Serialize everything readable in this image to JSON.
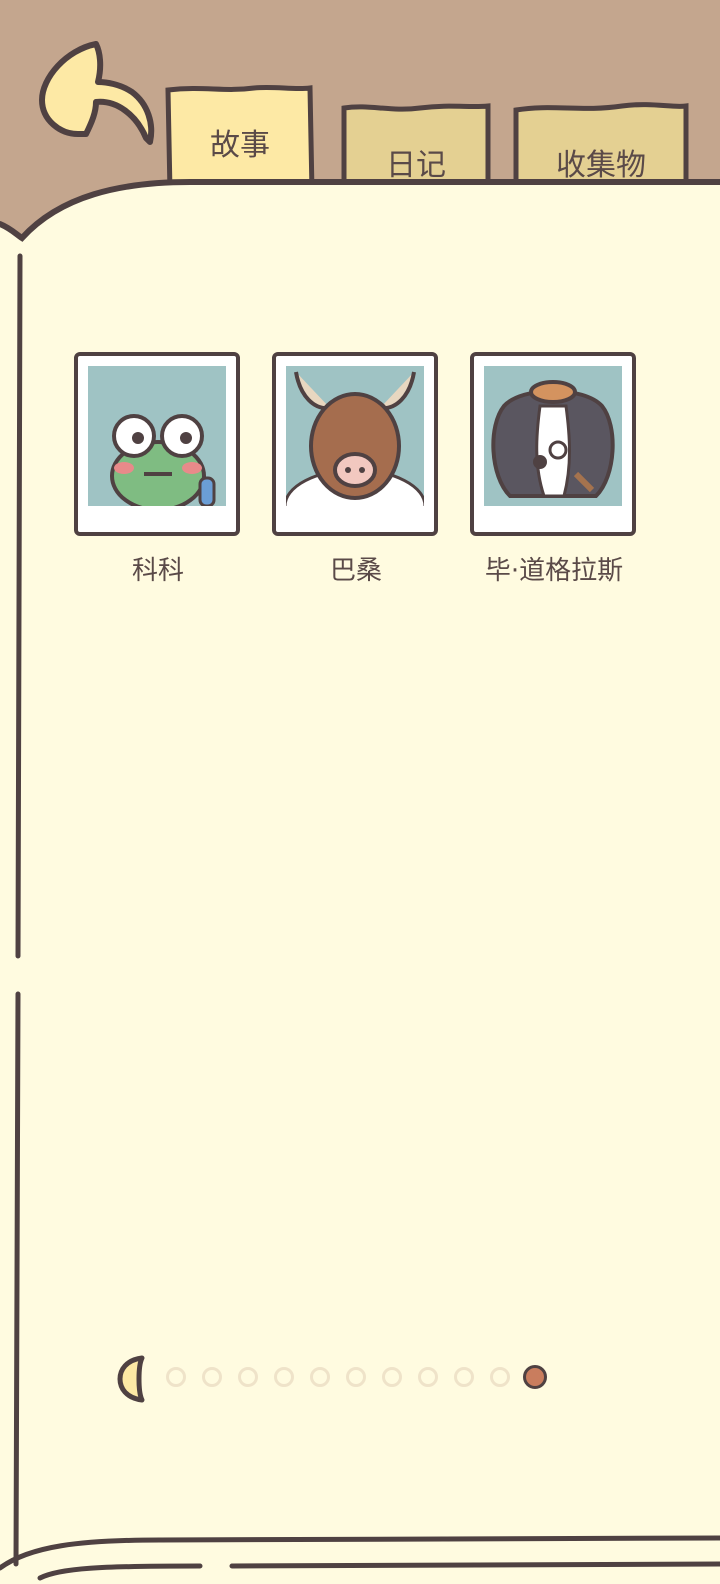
{
  "tabs": [
    {
      "label": "故事",
      "active": true
    },
    {
      "label": "日记",
      "active": false
    },
    {
      "label": "收集物",
      "active": false
    }
  ],
  "characters": [
    {
      "name": "科科",
      "icon": "frog-portrait"
    },
    {
      "name": "巴桑",
      "icon": "yak-portrait"
    },
    {
      "name": "毕·道格拉斯",
      "icon": "dog-portrait"
    }
  ],
  "pagination": {
    "total_dots": 11,
    "current": 11
  },
  "colors": {
    "background_brown": "#c4a68e",
    "paper": "#fffbe0",
    "tab_active": "#fde9a5",
    "tab_inactive": "#e4d092",
    "outline": "#4f4142",
    "portrait_bg": "#9fc3c4",
    "active_dot": "#c97d5e"
  }
}
